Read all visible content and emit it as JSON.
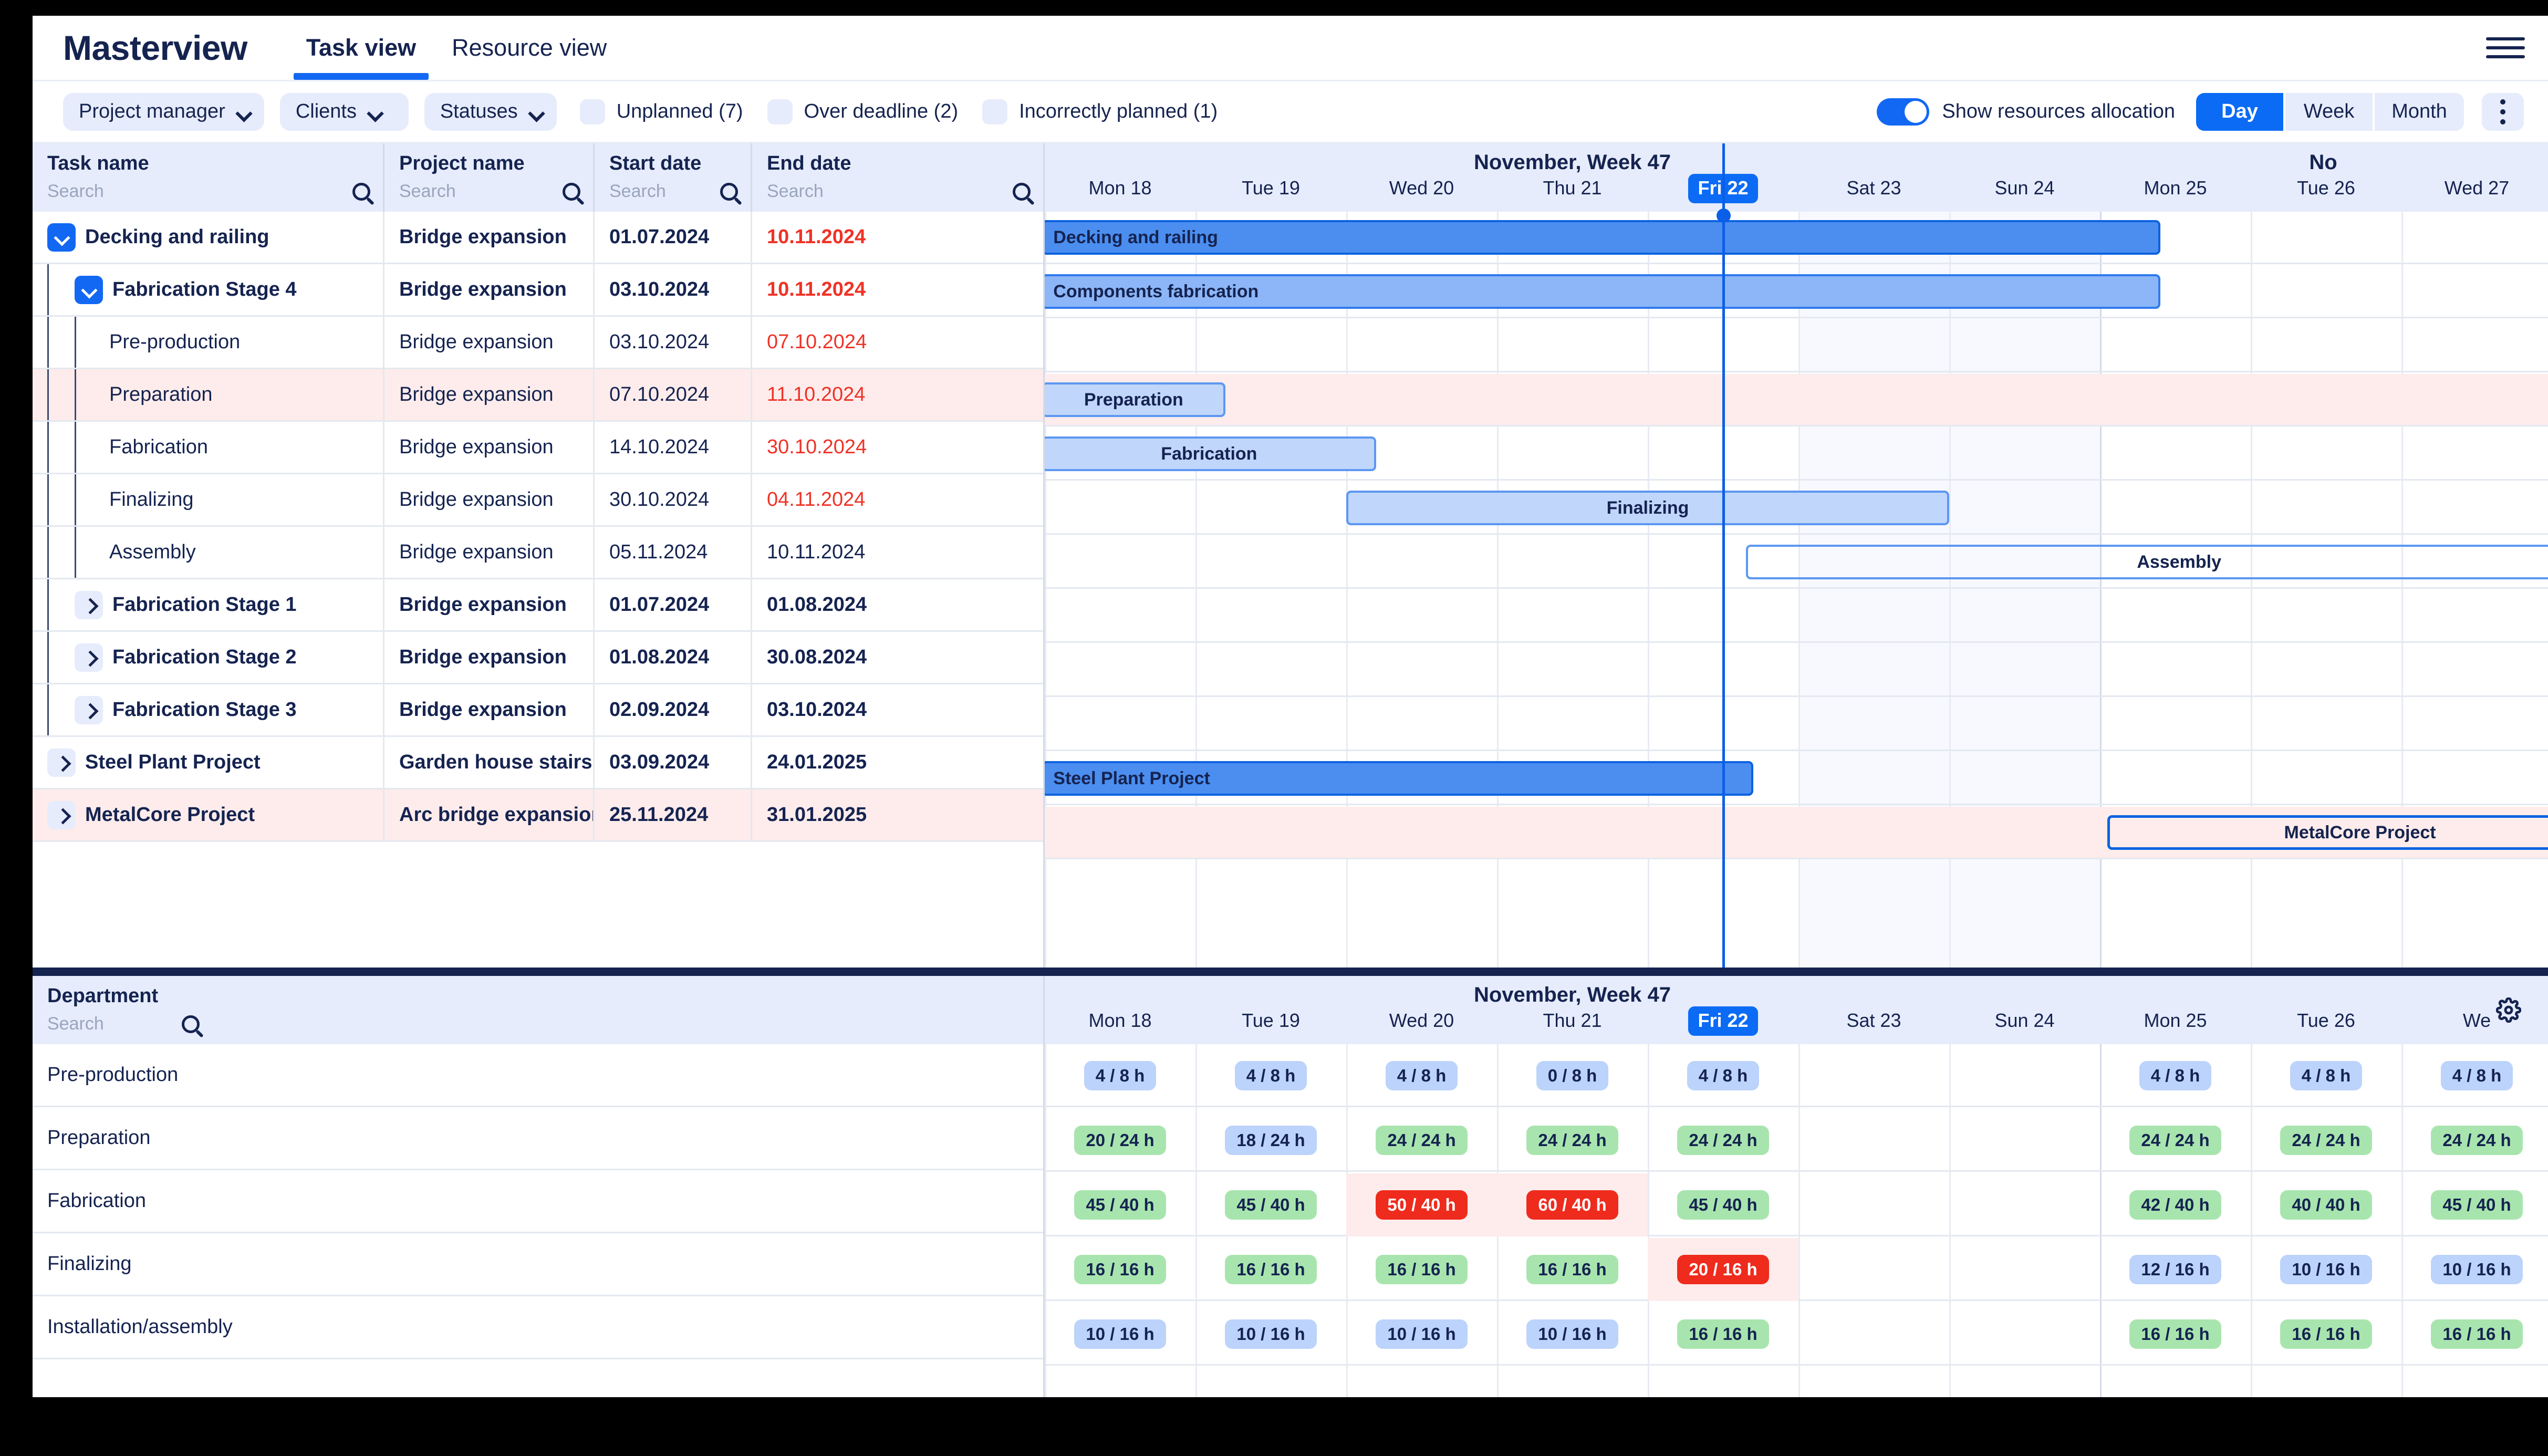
{
  "app": {
    "brand": "Masterview",
    "tabs": [
      {
        "label": "Task view",
        "active": true
      },
      {
        "label": "Resource view",
        "active": false
      }
    ],
    "menu_icon": "hamburger-menu-icon"
  },
  "toolbar": {
    "filters": [
      {
        "label": "Project manager",
        "icon": "chevron-down-icon"
      },
      {
        "label": "Clients",
        "icon": "chevron-down-icon"
      },
      {
        "label": "Statuses",
        "icon": "chevron-down-icon"
      }
    ],
    "checkboxes": [
      {
        "label": "Unplanned (7)",
        "checked": false
      },
      {
        "label": "Over deadline (2)",
        "checked": false
      },
      {
        "label": "Incorrectly planned (1)",
        "checked": false
      }
    ],
    "toggle": {
      "label": "Show resources allocation",
      "on": true,
      "color": "#1268f3"
    },
    "scale_buttons": [
      {
        "label": "Day",
        "active": true
      },
      {
        "label": "Week",
        "active": false
      },
      {
        "label": "Month",
        "active": false
      }
    ],
    "more_icon": "kebab-menu-icon"
  },
  "task_table": {
    "columns": [
      {
        "title": "Task name",
        "placeholder": "Search"
      },
      {
        "title": "Project name",
        "placeholder": "Search"
      },
      {
        "title": "Start date",
        "placeholder": "Search"
      },
      {
        "title": "End date",
        "placeholder": "Search"
      }
    ],
    "rows": [
      {
        "name": "Decking and railing",
        "project": "Bridge expansion",
        "start": "01.07.2024",
        "end": "10.11.2024",
        "level": 0,
        "bold": true,
        "end_red": true,
        "twist": "open",
        "alert": false
      },
      {
        "name": "Fabrication Stage 4",
        "project": "Bridge expansion",
        "start": "03.10.2024",
        "end": "10.11.2024",
        "level": 1,
        "bold": true,
        "end_red": true,
        "twist": "open",
        "alert": false
      },
      {
        "name": "Pre-production",
        "project": "Bridge expansion",
        "start": "03.10.2024",
        "end": "07.10.2024",
        "level": 2,
        "bold": false,
        "end_red": true,
        "twist": "none",
        "alert": false
      },
      {
        "name": "Preparation",
        "project": "Bridge expansion",
        "start": "07.10.2024",
        "end": "11.10.2024",
        "level": 2,
        "bold": false,
        "end_red": true,
        "twist": "none",
        "alert": true
      },
      {
        "name": "Fabrication",
        "project": "Bridge expansion",
        "start": "14.10.2024",
        "end": "30.10.2024",
        "level": 2,
        "bold": false,
        "end_red": true,
        "twist": "none",
        "alert": false
      },
      {
        "name": "Finalizing",
        "project": "Bridge expansion",
        "start": "30.10.2024",
        "end": "04.11.2024",
        "level": 2,
        "bold": false,
        "end_red": true,
        "twist": "none",
        "alert": false
      },
      {
        "name": "Assembly",
        "project": "Bridge expansion",
        "start": "05.11.2024",
        "end": "10.11.2024",
        "level": 2,
        "bold": false,
        "end_red": false,
        "twist": "none",
        "alert": false
      },
      {
        "name": "Fabrication Stage 1",
        "project": "Bridge expansion",
        "start": "01.07.2024",
        "end": "01.08.2024",
        "level": 1,
        "bold": true,
        "end_red": false,
        "twist": "closed",
        "alert": false
      },
      {
        "name": "Fabrication Stage 2",
        "project": "Bridge expansion",
        "start": "01.08.2024",
        "end": "30.08.2024",
        "level": 1,
        "bold": true,
        "end_red": false,
        "twist": "closed",
        "alert": false
      },
      {
        "name": "Fabrication Stage 3",
        "project": "Bridge expansion",
        "start": "02.09.2024",
        "end": "03.10.2024",
        "level": 1,
        "bold": true,
        "end_red": false,
        "twist": "closed",
        "alert": false
      },
      {
        "name": "Steel Plant Project",
        "project": "Garden house stairs",
        "start": "03.09.2024",
        "end": "24.01.2025",
        "level": 0,
        "bold": true,
        "end_red": false,
        "twist": "closed",
        "alert": false
      },
      {
        "name": "MetalCore Project",
        "project": "Arc bridge expansion",
        "start": "25.11.2024",
        "end": "31.01.2025",
        "level": 0,
        "bold": true,
        "end_red": false,
        "twist": "closed",
        "alert": true
      }
    ]
  },
  "timeline": {
    "month_label": "November, Week 47",
    "next_month_label": "No",
    "today": "Fri 22",
    "days": [
      {
        "label": "Mon 18",
        "today": false,
        "weekend": false
      },
      {
        "label": "Tue 19",
        "today": false,
        "weekend": false
      },
      {
        "label": "Wed 20",
        "today": false,
        "weekend": false
      },
      {
        "label": "Thu 21",
        "today": false,
        "weekend": false
      },
      {
        "label": "Fri 22",
        "today": true,
        "weekend": false
      },
      {
        "label": "Sat 23",
        "today": false,
        "weekend": true
      },
      {
        "label": "Sun 24",
        "today": false,
        "weekend": true
      },
      {
        "label": "Mon 25",
        "today": false,
        "weekend": false
      },
      {
        "label": "Tue 26",
        "today": false,
        "weekend": false
      },
      {
        "label": "Wed 27",
        "today": false,
        "weekend": false
      }
    ],
    "bars": [
      {
        "row": 0,
        "label": "Decking and railing",
        "style": "solid-dark",
        "start_col": -0.02,
        "end_col": 7.4,
        "align": "left"
      },
      {
        "row": 1,
        "label": "Components fabrication",
        "style": "solid-light",
        "start_col": -0.02,
        "end_col": 7.4,
        "align": "left"
      },
      {
        "row": 3,
        "label": "Preparation",
        "style": "fill-pale",
        "start_col": -0.02,
        "end_col": 1.2,
        "align": "center"
      },
      {
        "row": 4,
        "label": "Fabrication",
        "style": "fill-pale",
        "start_col": -0.02,
        "end_col": 2.2,
        "align": "center"
      },
      {
        "row": 5,
        "label": "Finalizing",
        "style": "fill-pale",
        "start_col": 2.0,
        "end_col": 6.0,
        "align": "center"
      },
      {
        "row": 6,
        "label": "Assembly",
        "style": "outline",
        "start_col": 4.65,
        "end_col": 10.4,
        "align": "center"
      },
      {
        "row": 10,
        "label": "Steel Plant Project",
        "style": "solid-dark",
        "start_col": -0.02,
        "end_col": 4.7,
        "align": "center"
      },
      {
        "row": 11,
        "label": "MetalCore Project",
        "style": "outline-strong",
        "start_col": 7.05,
        "end_col": 10.4,
        "align": "center"
      }
    ]
  },
  "resources": {
    "header": {
      "title": "Department",
      "placeholder": "Search",
      "month_label": "November, Week 47",
      "settings_icon": "gear-icon"
    },
    "days": [
      {
        "label": "Mon 18",
        "today": false
      },
      {
        "label": "Tue 19",
        "today": false
      },
      {
        "label": "Wed 20",
        "today": false
      },
      {
        "label": "Thu 21",
        "today": false
      },
      {
        "label": "Fri 22",
        "today": true
      },
      {
        "label": "Sat 23",
        "today": false
      },
      {
        "label": "Sun 24",
        "today": false
      },
      {
        "label": "Mon 25",
        "today": false
      },
      {
        "label": "Tue 26",
        "today": false
      },
      {
        "label": "We",
        "today": false
      }
    ],
    "rows": [
      {
        "department": "Pre-production",
        "cells": [
          {
            "text": "4 / 8 h",
            "color": "blue"
          },
          {
            "text": "4 / 8 h",
            "color": "blue"
          },
          {
            "text": "4 / 8 h",
            "color": "blue"
          },
          {
            "text": "0 / 8 h",
            "color": "blue"
          },
          {
            "text": "4 / 8 h",
            "color": "blue"
          },
          {
            "text": "",
            "color": "none"
          },
          {
            "text": "",
            "color": "none"
          },
          {
            "text": "4 / 8 h",
            "color": "blue"
          },
          {
            "text": "4 / 8 h",
            "color": "blue"
          },
          {
            "text": "4 / 8 h",
            "color": "blue"
          }
        ]
      },
      {
        "department": "Preparation",
        "cells": [
          {
            "text": "20 / 24 h",
            "color": "green"
          },
          {
            "text": "18 / 24 h",
            "color": "blue"
          },
          {
            "text": "24 / 24 h",
            "color": "green"
          },
          {
            "text": "24 / 24 h",
            "color": "green"
          },
          {
            "text": "24 / 24 h",
            "color": "green"
          },
          {
            "text": "",
            "color": "none"
          },
          {
            "text": "",
            "color": "none"
          },
          {
            "text": "24 / 24 h",
            "color": "green"
          },
          {
            "text": "24 / 24 h",
            "color": "green"
          },
          {
            "text": "24 / 24 h",
            "color": "green"
          }
        ]
      },
      {
        "department": "Fabrication",
        "cells": [
          {
            "text": "45 / 40 h",
            "color": "green"
          },
          {
            "text": "45 / 40 h",
            "color": "green"
          },
          {
            "text": "50 / 40 h",
            "color": "red"
          },
          {
            "text": "60 / 40 h",
            "color": "red"
          },
          {
            "text": "45 / 40 h",
            "color": "green"
          },
          {
            "text": "",
            "color": "none"
          },
          {
            "text": "",
            "color": "none"
          },
          {
            "text": "42 / 40 h",
            "color": "green"
          },
          {
            "text": "40 / 40 h",
            "color": "green"
          },
          {
            "text": "45 / 40 h",
            "color": "green"
          }
        ]
      },
      {
        "department": "Finalizing",
        "cells": [
          {
            "text": "16 / 16 h",
            "color": "green"
          },
          {
            "text": "16 / 16 h",
            "color": "green"
          },
          {
            "text": "16 / 16 h",
            "color": "green"
          },
          {
            "text": "16 / 16 h",
            "color": "green"
          },
          {
            "text": "20 / 16 h",
            "color": "red"
          },
          {
            "text": "",
            "color": "none"
          },
          {
            "text": "",
            "color": "none"
          },
          {
            "text": "12 / 16 h",
            "color": "blue"
          },
          {
            "text": "10 / 16 h",
            "color": "blue"
          },
          {
            "text": "10 / 16 h",
            "color": "blue"
          }
        ]
      },
      {
        "department": "Installation/assembly",
        "cells": [
          {
            "text": "10 / 16 h",
            "color": "blue"
          },
          {
            "text": "10 / 16 h",
            "color": "blue"
          },
          {
            "text": "10 / 16 h",
            "color": "blue"
          },
          {
            "text": "10 / 16 h",
            "color": "blue"
          },
          {
            "text": "16 / 16 h",
            "color": "green"
          },
          {
            "text": "",
            "color": "none"
          },
          {
            "text": "",
            "color": "none"
          },
          {
            "text": "16 / 16 h",
            "color": "green"
          },
          {
            "text": "16 / 16 h",
            "color": "green"
          },
          {
            "text": "16 / 16 h",
            "color": "green"
          }
        ]
      }
    ]
  },
  "colors": {
    "accent": "#1268f3",
    "danger": "#f03226",
    "ok": "#a8e5ae",
    "info": "#bcd3fb",
    "dark": "#152350"
  }
}
